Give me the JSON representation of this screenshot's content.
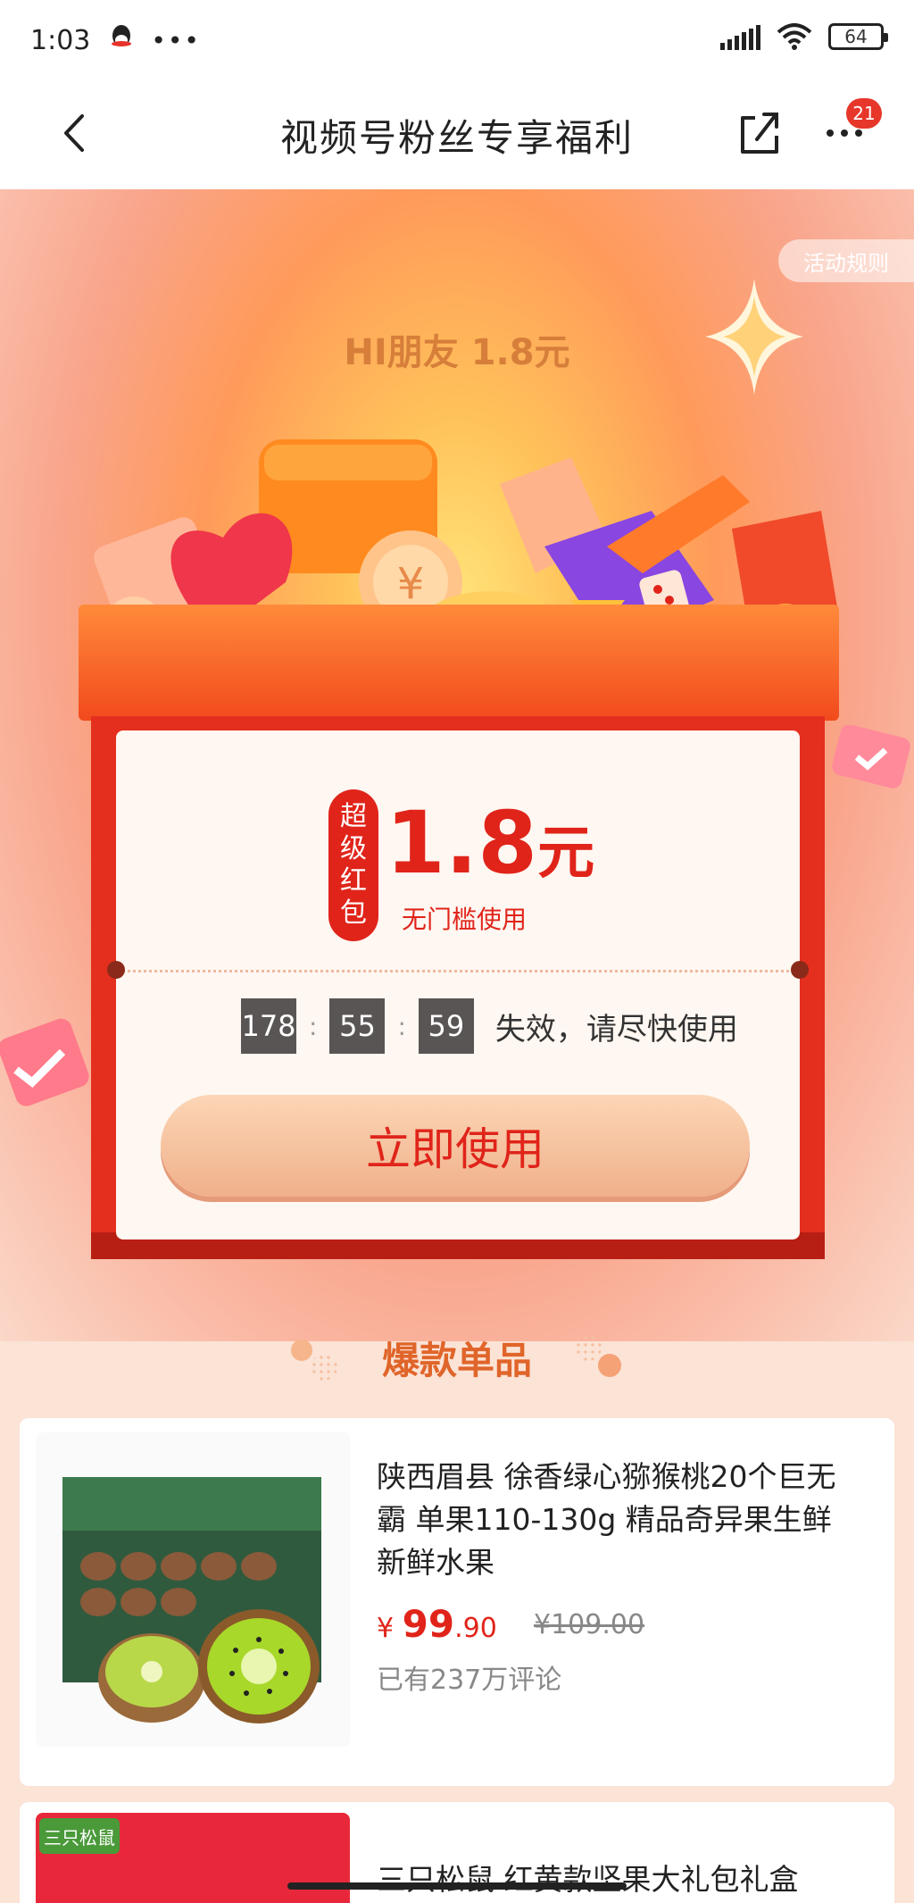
{
  "status_bar": {
    "time": "1:03",
    "dots": "•••",
    "battery": "64"
  },
  "nav": {
    "title": "视频号粉丝专享福利",
    "badge": "21"
  },
  "hero": {
    "rules_label": "活动规则",
    "greeting": "HI朋友  1.8元",
    "tag_chars": [
      "超",
      "级",
      "红",
      "包"
    ],
    "amount": "1.8",
    "amount_unit": "元",
    "threshold": "无门槛使用",
    "countdown": {
      "hours": "178",
      "minutes": "55",
      "seconds": "59",
      "sep": ":",
      "suffix": "失效，请尽快使用"
    },
    "use_button": "立即使用"
  },
  "section": {
    "title": "爆款单品"
  },
  "products": [
    {
      "name": "陕西眉县 徐香绿心猕猴桃20个巨无霸 单果110-130g 精品奇异果生鲜 新鲜水果",
      "currency": "¥",
      "price_int": "99",
      "price_dec": ".90",
      "orig_price": "¥109.00",
      "reviews": "已有237万评论"
    },
    {
      "name": "三只松鼠 红黄款坚果大礼包礼盒",
      "logo": "三只松鼠"
    }
  ],
  "colors": {
    "accent": "#e0241a",
    "section": "#e0652a"
  }
}
